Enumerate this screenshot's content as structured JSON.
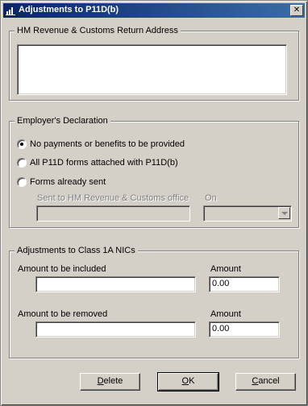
{
  "window": {
    "title": "Adjustments  to P11D(b)",
    "close_glyph": "✕"
  },
  "return_address": {
    "legend": "HM Revenue & Customs Return Address",
    "value": ""
  },
  "declaration": {
    "legend": "Employer's Declaration",
    "options": [
      {
        "label": "No payments or benefits to be provided",
        "selected": true
      },
      {
        "label": "All P11D forms attached with P11D(b)",
        "selected": false
      },
      {
        "label": "Forms already sent",
        "selected": false
      }
    ],
    "sent_to_label": "Sent to HM Revenue & Customs office",
    "sent_to_value": "",
    "on_label": "On",
    "on_value": ""
  },
  "class1a": {
    "legend": "Adjustments to Class 1A NICs",
    "included_label": "Amount to be included",
    "included_value": "",
    "included_amount_label": "Amount",
    "included_amount_value": "0.00",
    "removed_label": "Amount to be removed",
    "removed_value": "",
    "removed_amount_label": "Amount",
    "removed_amount_value": "0.00"
  },
  "buttons": {
    "delete": {
      "mnemonic": "D",
      "rest": "elete"
    },
    "ok": {
      "mnemonic": "O",
      "rest": "K"
    },
    "cancel": {
      "mnemonic": "C",
      "rest": "ancel"
    }
  }
}
